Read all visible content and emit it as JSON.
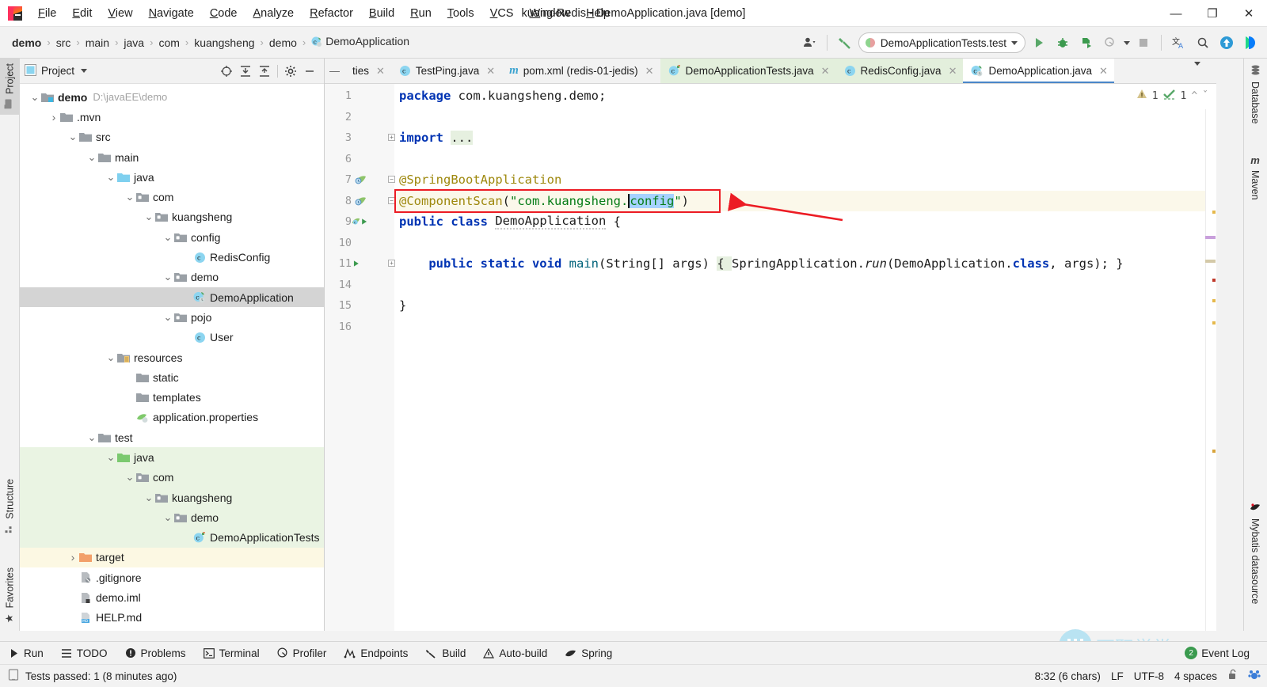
{
  "window": {
    "title": "kuang-Redis - DemoApplication.java [demo]",
    "controls": {
      "minimize": "—",
      "maximize": "❐",
      "close": "✕"
    }
  },
  "menubar": [
    {
      "label": "File"
    },
    {
      "label": "Edit"
    },
    {
      "label": "View"
    },
    {
      "label": "Navigate"
    },
    {
      "label": "Code"
    },
    {
      "label": "Analyze"
    },
    {
      "label": "Refactor"
    },
    {
      "label": "Build"
    },
    {
      "label": "Run"
    },
    {
      "label": "Tools"
    },
    {
      "label": "VCS"
    },
    {
      "label": "Window"
    },
    {
      "label": "Help"
    }
  ],
  "breadcrumb": [
    "demo",
    "src",
    "main",
    "java",
    "com",
    "kuangsheng",
    "demo",
    "DemoApplication"
  ],
  "toolbar": {
    "run_config": "DemoApplicationTests.test",
    "icons": [
      "user-avatar-icon",
      "hammer-build-icon",
      "run-icon",
      "debug-icon",
      "run-coverage-icon",
      "profile-icon",
      "stop-icon",
      "translate-icon",
      "search-everywhere-icon",
      "update-icon",
      "idea-icon"
    ]
  },
  "left_tool_strip": [
    {
      "label": "Project",
      "active": true,
      "icon": "project-icon"
    },
    {
      "label": "Structure",
      "active": false,
      "icon": "structure-icon"
    },
    {
      "label": "Favorites",
      "active": false,
      "icon": "star-icon"
    }
  ],
  "right_tool_strip": [
    {
      "label": "Database",
      "icon": "database-icon"
    },
    {
      "label": "Maven",
      "icon": "maven-icon"
    },
    {
      "label": "Mybatis datasource",
      "icon": "mybatis-icon"
    }
  ],
  "project_panel": {
    "title": "Project",
    "header_icons": [
      "locate-icon",
      "expand-all-icon",
      "collapse-all-icon",
      "gear-icon",
      "hide-icon"
    ],
    "tree": [
      {
        "depth": 0,
        "arrow": "down",
        "icon": "module-folder",
        "label": "demo",
        "bold": true,
        "sub": "D:\\javaEE\\demo"
      },
      {
        "depth": 1,
        "arrow": "right",
        "icon": "folder",
        "label": ".mvn"
      },
      {
        "depth": 2,
        "arrow": "down",
        "icon": "folder",
        "label": "src"
      },
      {
        "depth": 3,
        "arrow": "down",
        "icon": "folder",
        "label": "main"
      },
      {
        "depth": 4,
        "arrow": "down",
        "icon": "source-folder",
        "label": "java"
      },
      {
        "depth": 5,
        "arrow": "down",
        "icon": "package",
        "label": "com"
      },
      {
        "depth": 6,
        "arrow": "down",
        "icon": "package",
        "label": "kuangsheng"
      },
      {
        "depth": 7,
        "arrow": "down",
        "icon": "package",
        "label": "config"
      },
      {
        "depth": 8,
        "arrow": "none",
        "icon": "class",
        "label": "RedisConfig"
      },
      {
        "depth": 7,
        "arrow": "down",
        "icon": "package",
        "label": "demo"
      },
      {
        "depth": 8,
        "arrow": "none",
        "icon": "spring-class",
        "label": "DemoApplication",
        "selected": true
      },
      {
        "depth": 7,
        "arrow": "down",
        "icon": "package",
        "label": "pojo"
      },
      {
        "depth": 8,
        "arrow": "none",
        "icon": "class",
        "label": "User"
      },
      {
        "depth": 4,
        "arrow": "down",
        "icon": "resource-folder",
        "label": "resources"
      },
      {
        "depth": 5,
        "arrow": "none",
        "icon": "folder",
        "label": "static"
      },
      {
        "depth": 5,
        "arrow": "none",
        "icon": "folder",
        "label": "templates"
      },
      {
        "depth": 5,
        "arrow": "none",
        "icon": "properties",
        "label": "application.properties"
      },
      {
        "depth": 3,
        "arrow": "down",
        "icon": "folder",
        "label": "test"
      },
      {
        "depth": 4,
        "arrow": "down",
        "icon": "test-folder",
        "label": "java",
        "green": true
      },
      {
        "depth": 5,
        "arrow": "down",
        "icon": "package",
        "label": "com",
        "green": true
      },
      {
        "depth": 6,
        "arrow": "down",
        "icon": "package",
        "label": "kuangsheng",
        "green": true
      },
      {
        "depth": 7,
        "arrow": "down",
        "icon": "package",
        "label": "demo",
        "green": true
      },
      {
        "depth": 8,
        "arrow": "none",
        "icon": "test-class",
        "label": "DemoApplicationTests",
        "green": true
      },
      {
        "depth": 2,
        "arrow": "right",
        "icon": "target-folder",
        "label": "target",
        "yellow": true
      },
      {
        "depth": 2,
        "arrow": "none",
        "icon": "gitignore",
        "label": ".gitignore"
      },
      {
        "depth": 2,
        "arrow": "none",
        "icon": "iml",
        "label": "demo.iml"
      },
      {
        "depth": 2,
        "arrow": "none",
        "icon": "markdown",
        "label": "HELP.md"
      }
    ]
  },
  "editor_tabs": [
    {
      "label": "ties",
      "icon": "properties-icon",
      "state": "plain",
      "truncated": true
    },
    {
      "label": "TestPing.java",
      "icon": "class-icon",
      "state": "plain"
    },
    {
      "label": "pom.xml (redis-01-jedis)",
      "icon": "maven-icon",
      "state": "plain"
    },
    {
      "label": "DemoApplicationTests.java",
      "icon": "test-class-icon",
      "state": "green"
    },
    {
      "label": "RedisConfig.java",
      "icon": "class-icon",
      "state": "green"
    },
    {
      "label": "DemoApplication.java",
      "icon": "spring-class-icon",
      "state": "active"
    }
  ],
  "inspection": {
    "warning_count": "1",
    "ok_count": "1"
  },
  "code": {
    "lines": [
      {
        "num": "1",
        "marker": "",
        "fold": "",
        "tokens": [
          {
            "t": "package ",
            "c": "kw"
          },
          {
            "t": "com.kuangsheng.demo;",
            "c": "plain"
          }
        ]
      },
      {
        "num": "2",
        "marker": "",
        "fold": "",
        "tokens": []
      },
      {
        "num": "3",
        "marker": "",
        "fold": "plus",
        "tokens": [
          {
            "t": "import ",
            "c": "kw"
          },
          {
            "t": "...",
            "c": "folded"
          }
        ]
      },
      {
        "num": "6",
        "marker": "",
        "fold": "",
        "tokens": []
      },
      {
        "num": "7",
        "marker": "spring-bean",
        "fold": "minus",
        "tokens": [
          {
            "t": "@SpringBootApplication",
            "c": "ann"
          }
        ]
      },
      {
        "num": "8",
        "marker": "spring-bean",
        "fold": "minus",
        "highlight": true,
        "tokens": [
          {
            "t": "@ComponentScan",
            "c": "ann"
          },
          {
            "t": "(",
            "c": "plain"
          },
          {
            "t": "\"com.kuangsheng.",
            "c": "str"
          },
          {
            "t": "CARET",
            "c": "caret"
          },
          {
            "t": "config",
            "c": "sel"
          },
          {
            "t": "\"",
            "c": "str"
          },
          {
            "t": ")",
            "c": "plain"
          }
        ]
      },
      {
        "num": "9",
        "marker": "spring-class-run",
        "fold": "",
        "tokens": [
          {
            "t": "public class ",
            "c": "kw"
          },
          {
            "t": "DemoApplication",
            "c": "wavy"
          },
          {
            "t": " {",
            "c": "plain"
          }
        ]
      },
      {
        "num": "10",
        "marker": "",
        "fold": "",
        "tokens": []
      },
      {
        "num": "11",
        "marker": "run",
        "fold": "plus",
        "tokens": [
          {
            "t": "    ",
            "c": "plain"
          },
          {
            "t": "public static void ",
            "c": "kw"
          },
          {
            "t": "main",
            "c": "method"
          },
          {
            "t": "(",
            "c": "plain"
          },
          {
            "t": "String",
            "c": "plain"
          },
          {
            "t": "[] args) ",
            "c": "plain"
          },
          {
            "t": "{ ",
            "c": "folded"
          },
          {
            "t": "SpringApplication.",
            "c": "plain"
          },
          {
            "t": "run",
            "c": "ital"
          },
          {
            "t": "(DemoApplication.",
            "c": "plain"
          },
          {
            "t": "class",
            "c": "kw"
          },
          {
            "t": ", args); ",
            "c": "plain"
          },
          {
            "t": "}",
            "c": "plain"
          }
        ]
      },
      {
        "num": "14",
        "marker": "",
        "fold": "",
        "tokens": []
      },
      {
        "num": "15",
        "marker": "",
        "fold": "",
        "tokens": [
          {
            "t": "}",
            "c": "plain"
          }
        ]
      },
      {
        "num": "16",
        "marker": "",
        "fold": "",
        "tokens": []
      }
    ]
  },
  "annotation": {
    "box_label": "red-highlight-box-around-componentscan",
    "arrow_label": "red-pointer-arrow",
    "color": "#ec1c24"
  },
  "bottom_bar": [
    {
      "label": "Run",
      "icon": "run-icon"
    },
    {
      "label": "TODO",
      "icon": "todo-icon"
    },
    {
      "label": "Problems",
      "icon": "problems-icon"
    },
    {
      "label": "Terminal",
      "icon": "terminal-icon"
    },
    {
      "label": "Profiler",
      "icon": "profiler-icon"
    },
    {
      "label": "Endpoints",
      "icon": "endpoints-icon"
    },
    {
      "label": "Build",
      "icon": "build-icon"
    },
    {
      "label": "Auto-build",
      "icon": "auto-build-icon"
    },
    {
      "label": "Spring",
      "icon": "spring-icon"
    }
  ],
  "event_log": {
    "label": "Event Log",
    "count": "2"
  },
  "watermark": {
    "text": "万职学堂"
  },
  "status_bar": {
    "message": "Tests passed: 1 (8 minutes ago)",
    "caret_position": "8:32 (6 chars)",
    "line_separator": "LF",
    "encoding": "UTF-8",
    "indent": "4 spaces",
    "lock_icon": "unlocked-icon",
    "ide_icon": "inspector-icon"
  },
  "colors": {
    "accent_blue": "#4a86c8",
    "annotation_red": "#ec1c24",
    "test_green": "#eaf4e3",
    "selection_blue": "#a6d2ff",
    "highlight_row": "#fbf8ea"
  }
}
